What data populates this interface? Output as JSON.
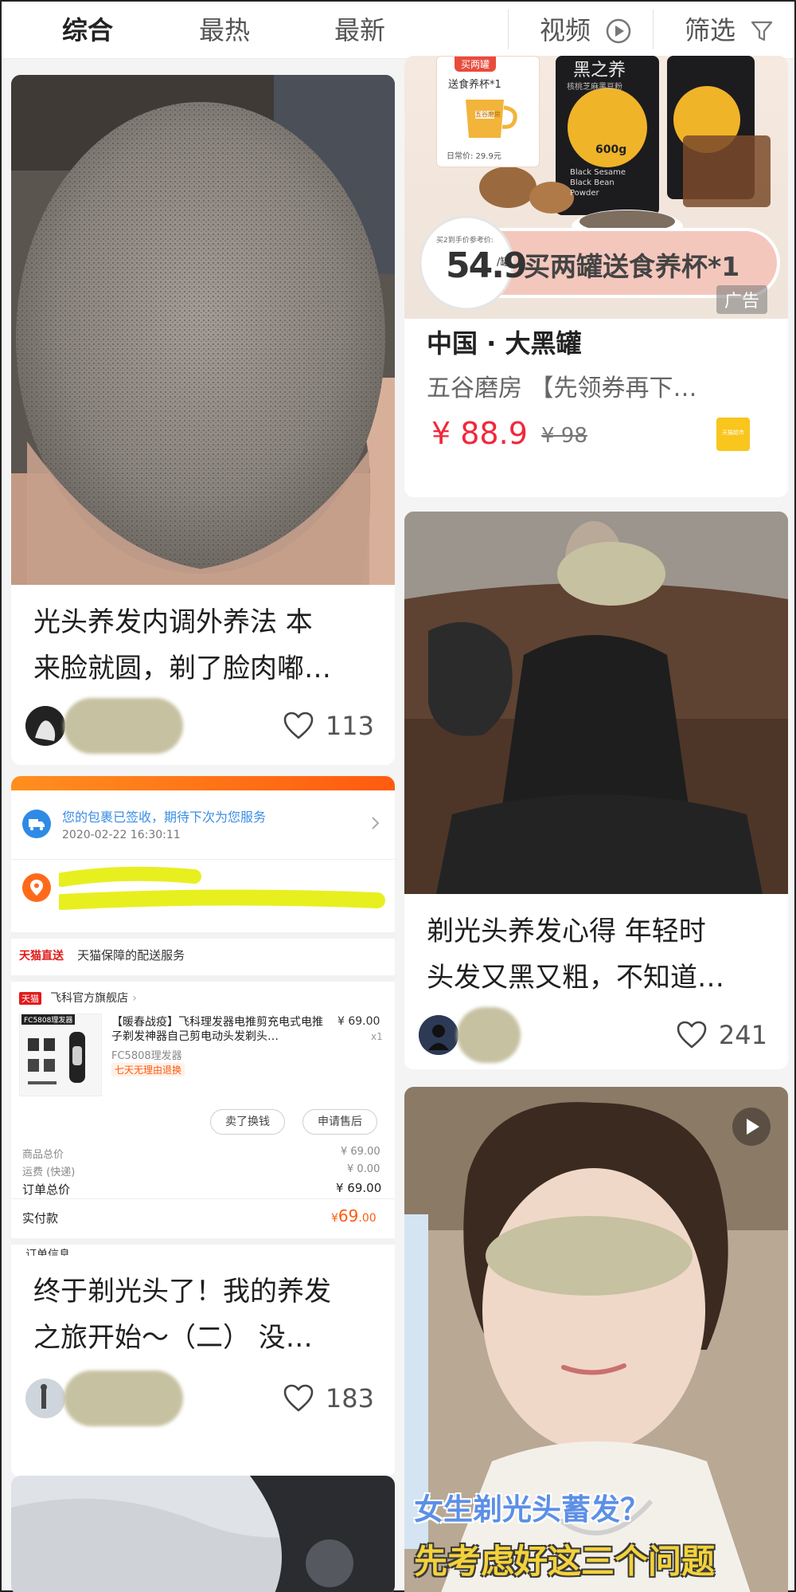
{
  "tabs": {
    "items": [
      "综合",
      "最热",
      "最新"
    ],
    "video_label": "视频",
    "filter_label": "筛选"
  },
  "left_cards": [
    {
      "title_line1": "光头养发内调外养法 本",
      "title_line2": "来脸就圆，剃了脸肉嘟…",
      "likes": "113"
    },
    {
      "order": {
        "delivery_status": "您的包裹已签收，期待下次为您服务",
        "delivery_time": "2020-02-22 16:30:11",
        "tmall_tag": "天猫直送",
        "tmall_service": "天猫保障的配送服务",
        "shop_tag": "天猫",
        "shop_name": "飞科官方旗舰店",
        "product_title": "【暖春战疫】飞科理发器电推剪充电式电推子剃发神器自己剪电动头发剃头…",
        "product_sku": "FC5808理发器",
        "product_promise": "七天无理由退换",
        "product_price": "¥ 69.00",
        "product_qty": "x1",
        "thumb_label": "FC5808理发器",
        "btn_sell": "卖了换钱",
        "btn_after_sale": "申请售后",
        "goods_total_label": "商品总价",
        "goods_total_value": "¥ 69.00",
        "shipping_label": "运费 (快递)",
        "shipping_value": "¥ 0.00",
        "order_total_label": "订单总价",
        "order_total_value": "¥ 69.00",
        "paid_label": "实付款",
        "paid_currency": "¥",
        "paid_int": "69",
        "paid_dec": ".00",
        "next_section": "订单信息"
      },
      "title_line1": "终于剃光头了！我的养发",
      "title_line2": "之旅开始～（二） 没…",
      "likes": "183"
    }
  ],
  "right_cards": [
    {
      "ad": {
        "promo_tag": "买两罐",
        "promo_gift": "送食养杯*1",
        "cup_brand": "五谷磨房",
        "daily_price": "日常价: 29.9元",
        "product_name": "黑之养",
        "product_desc": "核桃芝麻黑豆粉",
        "can_en1": "Black Sesame",
        "can_en2": "Black Bean",
        "can_en3": "Powder",
        "can_weight": "600g",
        "ref_label": "买2到手价参考价:",
        "ref_price": "54.9",
        "ref_unit": "/罐",
        "banner_text": "买两罐送食养杯*1",
        "badge": "广告",
        "title": "中国 · 大黑罐",
        "subtitle": "五谷磨房 【先领券再下…",
        "price": "¥ 88.9",
        "old_price": "¥ 98",
        "tmall_logo": "天猫超市"
      }
    },
    {
      "title_line1": "剃光头养发心得 年轻时",
      "title_line2": "头发又黑又粗，不知道…",
      "likes": "241"
    },
    {
      "caption_line1": "女生剃光头蓄发？",
      "caption_line2": "先考虑好这三个问题"
    }
  ]
}
